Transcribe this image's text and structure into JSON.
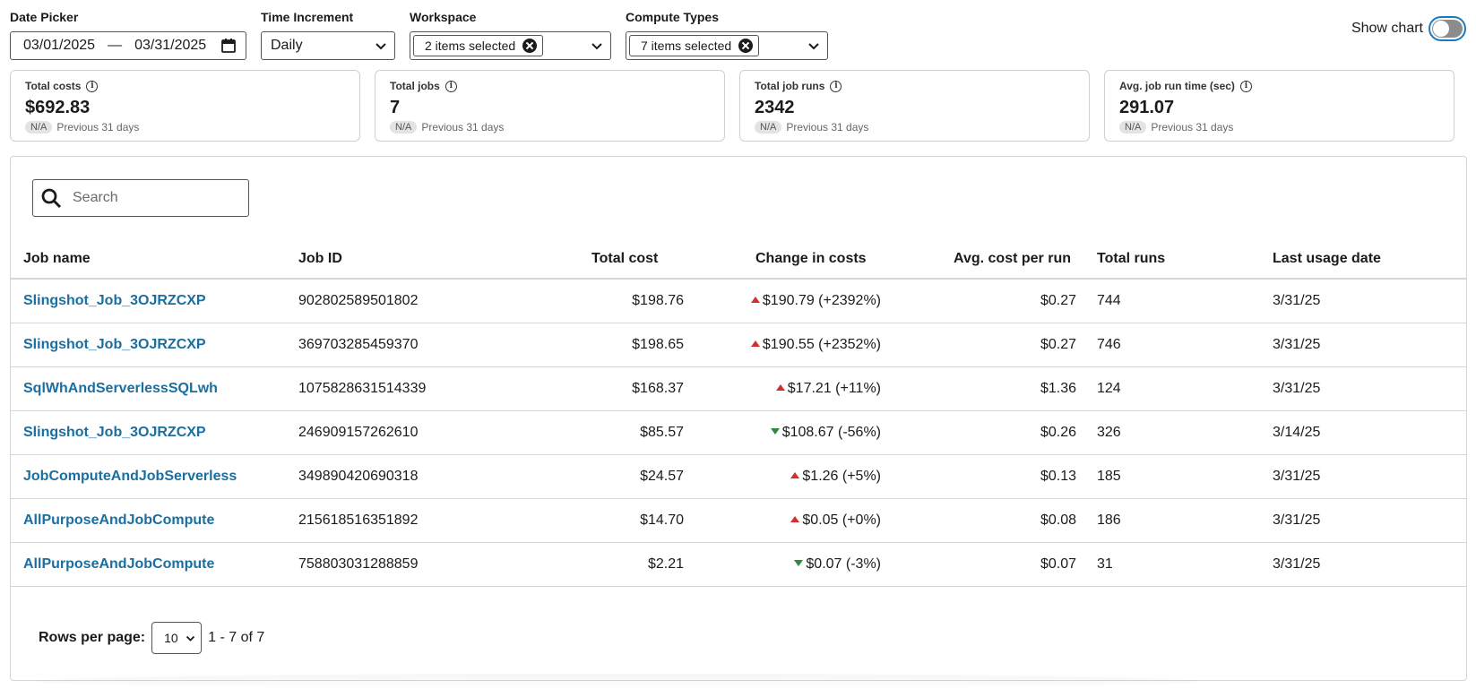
{
  "filters": {
    "date_picker": {
      "label": "Date Picker",
      "start": "03/01/2025",
      "separator": "—",
      "end": "03/31/2025"
    },
    "time_increment": {
      "label": "Time Increment",
      "value": "Daily"
    },
    "workspace": {
      "label": "Workspace",
      "chip": "2 items selected"
    },
    "compute_types": {
      "label": "Compute Types",
      "chip": "7 items selected"
    },
    "show_chart": {
      "label": "Show chart",
      "checked": false
    }
  },
  "kpis": [
    {
      "title": "Total costs",
      "value": "$692.83",
      "badge": "N/A",
      "sub": "Previous 31 days"
    },
    {
      "title": "Total jobs",
      "value": "7",
      "badge": "N/A",
      "sub": "Previous 31 days"
    },
    {
      "title": "Total job runs",
      "value": "2342",
      "badge": "N/A",
      "sub": "Previous 31 days"
    },
    {
      "title": "Avg. job run time (sec)",
      "value": "291.07",
      "badge": "N/A",
      "sub": "Previous 31 days"
    }
  ],
  "search": {
    "placeholder": "Search"
  },
  "table": {
    "columns": [
      "Job name",
      "Job ID",
      "Total cost",
      "Change in costs",
      "Avg. cost per run",
      "Total runs",
      "Last usage date"
    ],
    "rows": [
      {
        "name": "Slingshot_Job_3OJRZCXP",
        "id": "902802589501802",
        "cost": "$198.76",
        "dir": "up",
        "change": "$190.79 (+2392%)",
        "avg": "$0.27",
        "runs": "744",
        "last": "3/31/25"
      },
      {
        "name": "Slingshot_Job_3OJRZCXP",
        "id": "369703285459370",
        "cost": "$198.65",
        "dir": "up",
        "change": "$190.55 (+2352%)",
        "avg": "$0.27",
        "runs": "746",
        "last": "3/31/25"
      },
      {
        "name": "SqlWhAndServerlessSQLwh",
        "id": "1075828631514339",
        "cost": "$168.37",
        "dir": "up",
        "change": "$17.21 (+11%)",
        "avg": "$1.36",
        "runs": "124",
        "last": "3/31/25"
      },
      {
        "name": "Slingshot_Job_3OJRZCXP",
        "id": "246909157262610",
        "cost": "$85.57",
        "dir": "down",
        "change": "$108.67 (-56%)",
        "avg": "$0.26",
        "runs": "326",
        "last": "3/14/25"
      },
      {
        "name": "JobComputeAndJobServerless",
        "id": "349890420690318",
        "cost": "$24.57",
        "dir": "up",
        "change": "$1.26 (+5%)",
        "avg": "$0.13",
        "runs": "185",
        "last": "3/31/25"
      },
      {
        "name": "AllPurposeAndJobCompute",
        "id": "215618516351892",
        "cost": "$14.70",
        "dir": "up",
        "change": "$0.05 (+0%)",
        "avg": "$0.08",
        "runs": "186",
        "last": "3/31/25"
      },
      {
        "name": "AllPurposeAndJobCompute",
        "id": "758803031288859",
        "cost": "$2.21",
        "dir": "down",
        "change": "$0.07 (-3%)",
        "avg": "$0.07",
        "runs": "31",
        "last": "3/31/25"
      }
    ]
  },
  "pagination": {
    "label": "Rows per page:",
    "rows_per_page": "10",
    "range": "1 - 7 of 7"
  },
  "colors": {
    "link": "#1a6fa0",
    "increase": "#d32f2f",
    "decrease": "#2e8b3e",
    "toggle_focus": "#1a7ac0"
  }
}
